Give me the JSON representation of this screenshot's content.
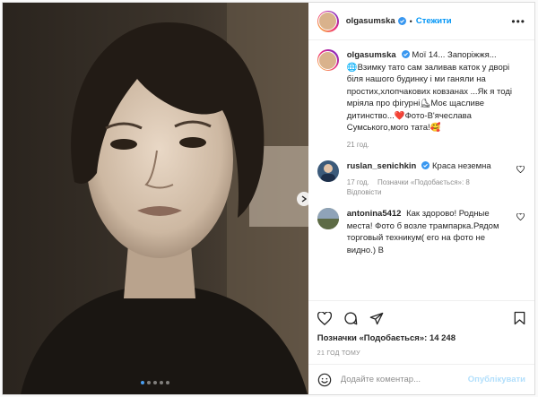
{
  "post": {
    "author": "olgasumska",
    "follow_label": "Стежити",
    "separator": "•",
    "more_label": "•••",
    "caption_text": "Мої 14... Запоріжжя...\n🌐Взимку тато сам заливав каток у дворі біля нашого будинку і ми ганяли на простих,хлопчакових ковзанах ...Як я тоді мріяла про фігурні⛸Моє щасливе дитинство...❤️Фото-В'ячеслава Сумського,мого тата!🥰",
    "caption_time": "21 год."
  },
  "comments": [
    {
      "user": "ruslan_senichkin",
      "verified": true,
      "text": "Краса неземна",
      "time": "17 год.",
      "likes": "Позначки «Подобається»: 8",
      "reply": "Відповісти"
    },
    {
      "user": "antonina5412",
      "verified": false,
      "text": "Как здорово! Родные места! Фото б возле трампарка.Рядом торговый техникум( его на фото не видно.) В",
      "time": "",
      "likes": "",
      "reply": ""
    }
  ],
  "footer": {
    "likes_text": "Позначки «Подобається»: 14 248",
    "ago": "21 год тому",
    "comment_placeholder": "Додайте коментар...",
    "publish_label": "Опублікувати"
  },
  "media": {
    "dot_count": 5,
    "active_dot": 0
  },
  "colors": {
    "accent": "#0095f6",
    "verified": "#3897f0",
    "heart": "#ed4956"
  }
}
